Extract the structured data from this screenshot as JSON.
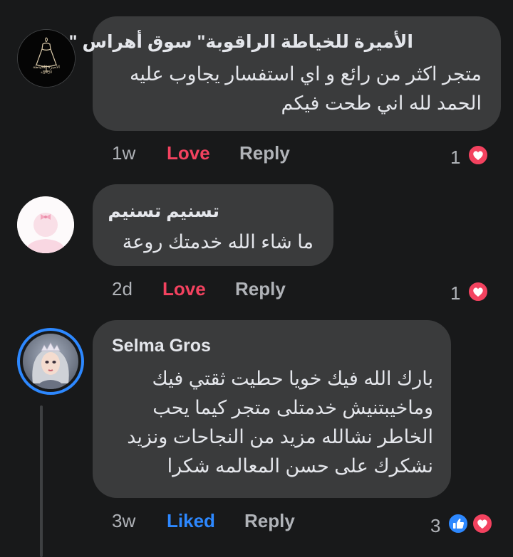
{
  "comments": [
    {
      "author": "الأميرة للخياطة الراقوبة\" سوق أهراس \"",
      "lines": [
        "متجر اكثر من رائع و اي استفسار يجاوب عليه",
        "الحمد لله اني طحت فيكم"
      ],
      "time": "1w",
      "reaction_label": "Love",
      "reply_label": "Reply",
      "reaction_count": "1"
    },
    {
      "author": "تسنيم تسنيم",
      "lines": [
        "ما شاء الله خدمتك روعة"
      ],
      "time": "2d",
      "reaction_label": "Love",
      "reply_label": "Reply",
      "reaction_count": "1"
    },
    {
      "author": "Selma Gros",
      "lines": [
        "بارك الله فيك خويا حطيت ثقتي فيك",
        "وماخيبتنيش خدمتلى متجر كيما يحب",
        "الخاطر نشالله مزيد من النجاحات ونزيد",
        "نشكرك على حسن المعالمه شكرا"
      ],
      "time": "3w",
      "reaction_label": "Liked",
      "reply_label": "Reply",
      "reaction_count": "3"
    }
  ],
  "avatars": {
    "page_logo_text": [
      "الأميرة للخياطة",
      "الراقوبة"
    ]
  },
  "icons": [
    "love-reaction-icon",
    "like-reaction-icon",
    "dress-logo",
    "bow-icon"
  ],
  "colors": {
    "background": "#18191a",
    "bubble": "#3a3b3c",
    "love": "#f3425f",
    "liked": "#2d88ff",
    "story_ring": "#2d88ff",
    "muted_text": "#b0b3b8"
  }
}
